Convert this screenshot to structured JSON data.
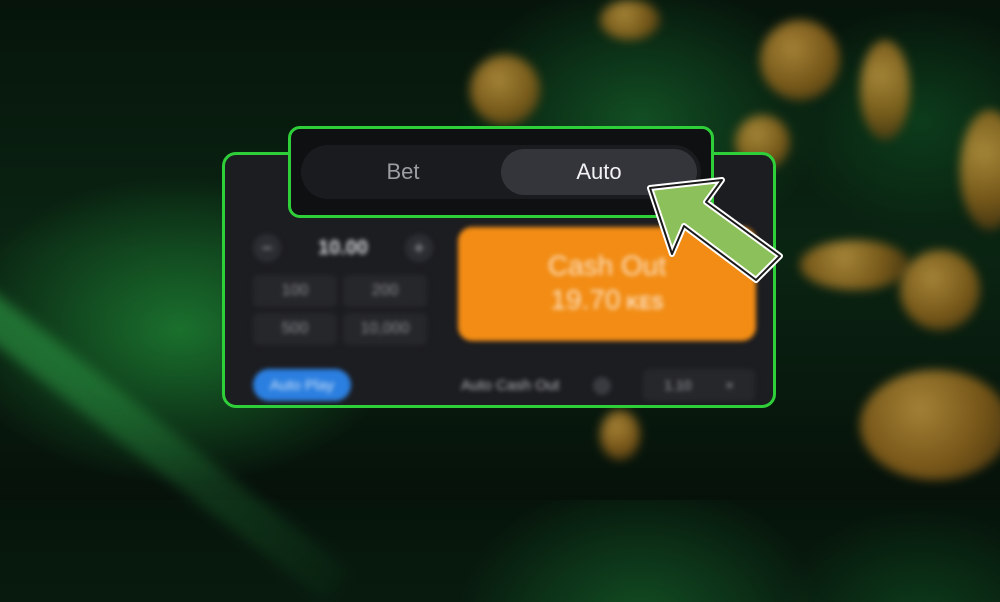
{
  "tabs": {
    "bet_label": "Bet",
    "auto_label": "Auto",
    "active": "Auto"
  },
  "stepper": {
    "minus": "−",
    "plus": "+",
    "amount": "10.00"
  },
  "quick_amounts": [
    "100",
    "200",
    "500",
    "10,000"
  ],
  "cashout": {
    "label": "Cash Out",
    "value": "19.70",
    "currency": "KES"
  },
  "autoplay_label": "Auto Play",
  "auto_cashout": {
    "label": "Auto Cash Out",
    "multiplier": "1.10",
    "clear": "×"
  },
  "colors": {
    "highlight_green": "#2fcf3a",
    "cashout_orange": "#f28c14",
    "autoplay_blue": "#2b7fe0",
    "arrow_green": "#8cc05a"
  },
  "icons": {
    "pointer": "arrow-pointer-icon"
  }
}
